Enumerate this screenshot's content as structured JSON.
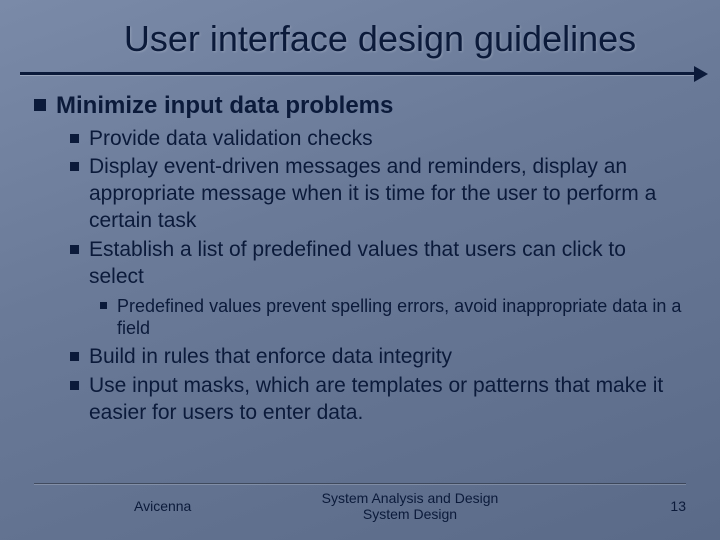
{
  "title": "User interface design guidelines",
  "l1": "Minimize input data problems",
  "l2": {
    "a": "Provide data validation checks",
    "b": "Display event-driven messages and reminders, display an appropriate message when it is time for the user to perform a certain task",
    "c": "Establish a list of predefined values that users can click to select",
    "d": "Build in rules that enforce data integrity",
    "e": "Use input masks, which are templates or patterns that make it easier for users to enter data."
  },
  "l3": {
    "a": "Predefined values prevent spelling errors, avoid inappropriate data in a field"
  },
  "footer": {
    "left": "Avicenna",
    "center_line1": "System Analysis and Design",
    "center_line2": "System Design",
    "page": "13"
  }
}
